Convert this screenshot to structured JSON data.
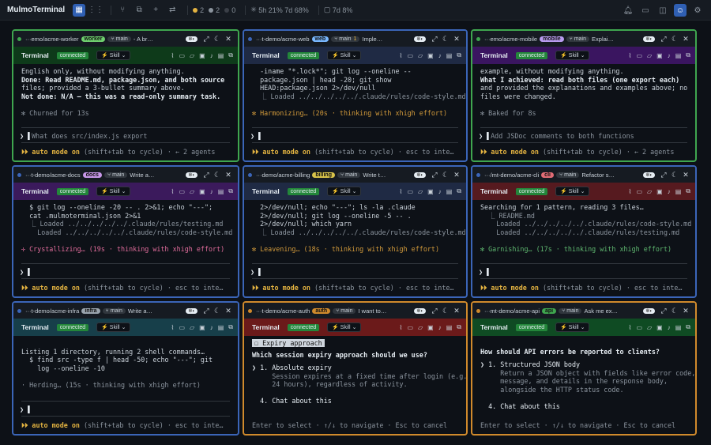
{
  "app_title": "MulmoTerminal",
  "topbar": {
    "stat_yellow": "2",
    "stat_gray": "2",
    "stat_zero": "0",
    "usage1": "5h 21% 7d 68%",
    "usage2": "7d 8%"
  },
  "colors": {
    "green": "#3fa64f",
    "blue": "#3b65b8",
    "orange": "#d08a2c"
  },
  "panes": [
    {
      "path": "···emo/acme-worker",
      "tag": "worker",
      "tag_color": "#6fd06f",
      "branch": "main",
      "desc": "- A br…",
      "dot": "#3fa64f",
      "terminal_label": "Terminal",
      "status": "connected",
      "skill": "Skill",
      "lines": [
        "English only, without modifying anything.",
        "Done: Read README.md, package.json, and both source",
        "files; provided a 3-bullet summary above.",
        "Not done: N/A — this was a read-only summary task.",
        "",
        "✻ Churned for 13s"
      ],
      "prompt": "What does src/index.js export",
      "footer": "(shift+tab to cycle) · ← 2 agents"
    },
    {
      "path": "···t-demo/acme-web",
      "tag": "web",
      "tag_color": "#79b8ff",
      "branch": "main",
      "branch_extra": "1",
      "desc": "Imple…",
      "dot": "#3b65b8",
      "terminal_label": "Terminal",
      "status": "connected",
      "skill": "Skill",
      "lines": [
        "  -iname \"*.lock*\"; git log --oneline --",
        "  package.json | head -20; git show",
        "  HEAD:package.json 2>/dev/null",
        "  ⎿ Loaded ../../../../../.claude/rules/code-style.md",
        "",
        "✻ Harmonizing… (20s · thinking with xhigh effort)"
      ],
      "prompt": "",
      "footer": "(shift+tab to cycle) · esc to inte…"
    },
    {
      "path": "···emo/acme-mobile",
      "tag": "mobile",
      "tag_color": "#b99cf0",
      "branch": "main",
      "desc": "Explai…",
      "dot": "#3fa64f",
      "terminal_label": "Terminal",
      "status": "connected",
      "skill": "Skill",
      "lines": [
        "example, without modifying anything.",
        "What I achieved: read both files (one export each)",
        "and provided the explanations and examples above; no",
        "files were changed.",
        "",
        "✻ Baked for 8s"
      ],
      "prompt": "Add JSDoc comments to both functions",
      "footer": "(shift+tab to cycle) · ← 2 agents"
    },
    {
      "path": "···t-demo/acme-docs",
      "tag": "docs",
      "tag_color": "#c797e8",
      "branch": "main",
      "desc": "Write a…",
      "dot": "#3b65b8",
      "terminal_label": "Terminal",
      "status": "connected",
      "skill": "Skill",
      "lines": [
        "  $ git log --oneline -20 -- . 2>&1; echo \"---\";",
        "  cat .mulmoterminal.json 2>&1",
        "  ⎿ Loaded ../../../../../.claude/rules/testing.md",
        "    Loaded ../../../../../.claude/rules/code-style.md",
        "",
        "✢ Crystallizing… (19s · thinking with xhigh effort)"
      ],
      "prompt": "",
      "footer": "(shift+tab to cycle) · esc to inte…"
    },
    {
      "path": "···demo/acme-billing",
      "tag": "billing",
      "tag_color": "#d7c24a",
      "branch": "main",
      "desc": "Write t…",
      "dot": "#3b65b8",
      "terminal_label": "Terminal",
      "status": "connected",
      "skill": "Skill",
      "lines": [
        "  2>/dev/null; echo \"---\"; ls -la .claude",
        "  2>/dev/null; git log --oneline -5 -- .",
        "  2>/dev/null; which yarn",
        "  ⎿ Loaded ../../../../../.claude/rules/code-style.md",
        "",
        "✻ Leavening… (18s · thinking with xhigh effort)"
      ],
      "prompt": "",
      "footer": "(shift+tab to cycle) · esc to inte…"
    },
    {
      "path": "···/mt-demo/acme-cli",
      "tag": "cli",
      "tag_color": "#e06c75",
      "branch": "main",
      "desc": "Refactor s…",
      "dot": "#3b65b8",
      "terminal_label": "Terminal",
      "status": "connected",
      "skill": "Skill",
      "lines": [
        "Searching for 1 pattern, reading 3 files…",
        "  ⎿ README.md",
        "    Loaded ../../../../../.claude/rules/code-style.md",
        "    Loaded ../../../../../.claude/rules/testing.md",
        "",
        "✻ Garnishing… (17s · thinking with xhigh effort)"
      ],
      "prompt": "",
      "footer": "(shift+tab to cycle) · esc to inte…"
    },
    {
      "path": "···t-demo/acme-infra",
      "tag": "infra",
      "tag_color": "#9aa4ad",
      "branch": "main",
      "desc": "Write a…",
      "dot": "#3b65b8",
      "terminal_label": "Terminal",
      "status": "connected",
      "skill": "Skill",
      "lines": [
        "",
        "Listing 1 directory, running 2 shell commands…",
        "  $ find src -type f | head -50; echo \"---\"; git",
        "    log --oneline -10",
        "",
        "· Herding… (15s · thinking with xhigh effort)"
      ],
      "prompt": "",
      "footer": "(shift+tab to cycle) · esc to inte…"
    },
    {
      "path": "···t-demo/acme-auth",
      "tag": "auth",
      "tag_color": "#d08a2c",
      "branch": "main",
      "desc": "I want to…",
      "dot": "#d08a2c",
      "terminal_label": "Terminal",
      "status": "connected",
      "skill": "Skill",
      "question_label": "☐ Expiry approach",
      "question": "Which session expiry approach should we use?",
      "options": [
        "❯ 1. Absolute expiry",
        "     Session expires at a fixed time after login (e.g.",
        "     24 hours), regardless of activity.",
        "",
        "  4. Chat about this"
      ],
      "hint": "Enter to select · ↑/↓ to navigate · Esc to cancel"
    },
    {
      "path": "···mt-demo/acme-api",
      "tag": "api",
      "tag_color": "#3fa64f",
      "branch": "main",
      "desc": "Ask me ex…",
      "dot": "#d08a2c",
      "terminal_label": "Terminal",
      "status": "connected",
      "skill": "Skill",
      "question": "How should API errors be reported to clients?",
      "options": [
        "❯ 1. Structured JSON body",
        "     Return a JSON object with fields like error code,",
        "     message, and details in the response body,",
        "     alongside the HTTP status code.",
        "",
        "  4. Chat about this"
      ],
      "hint": "Enter to select · ↑/↓ to navigate · Esc to cancel"
    }
  ],
  "auto_mode": "⏵⏵ auto mode on"
}
